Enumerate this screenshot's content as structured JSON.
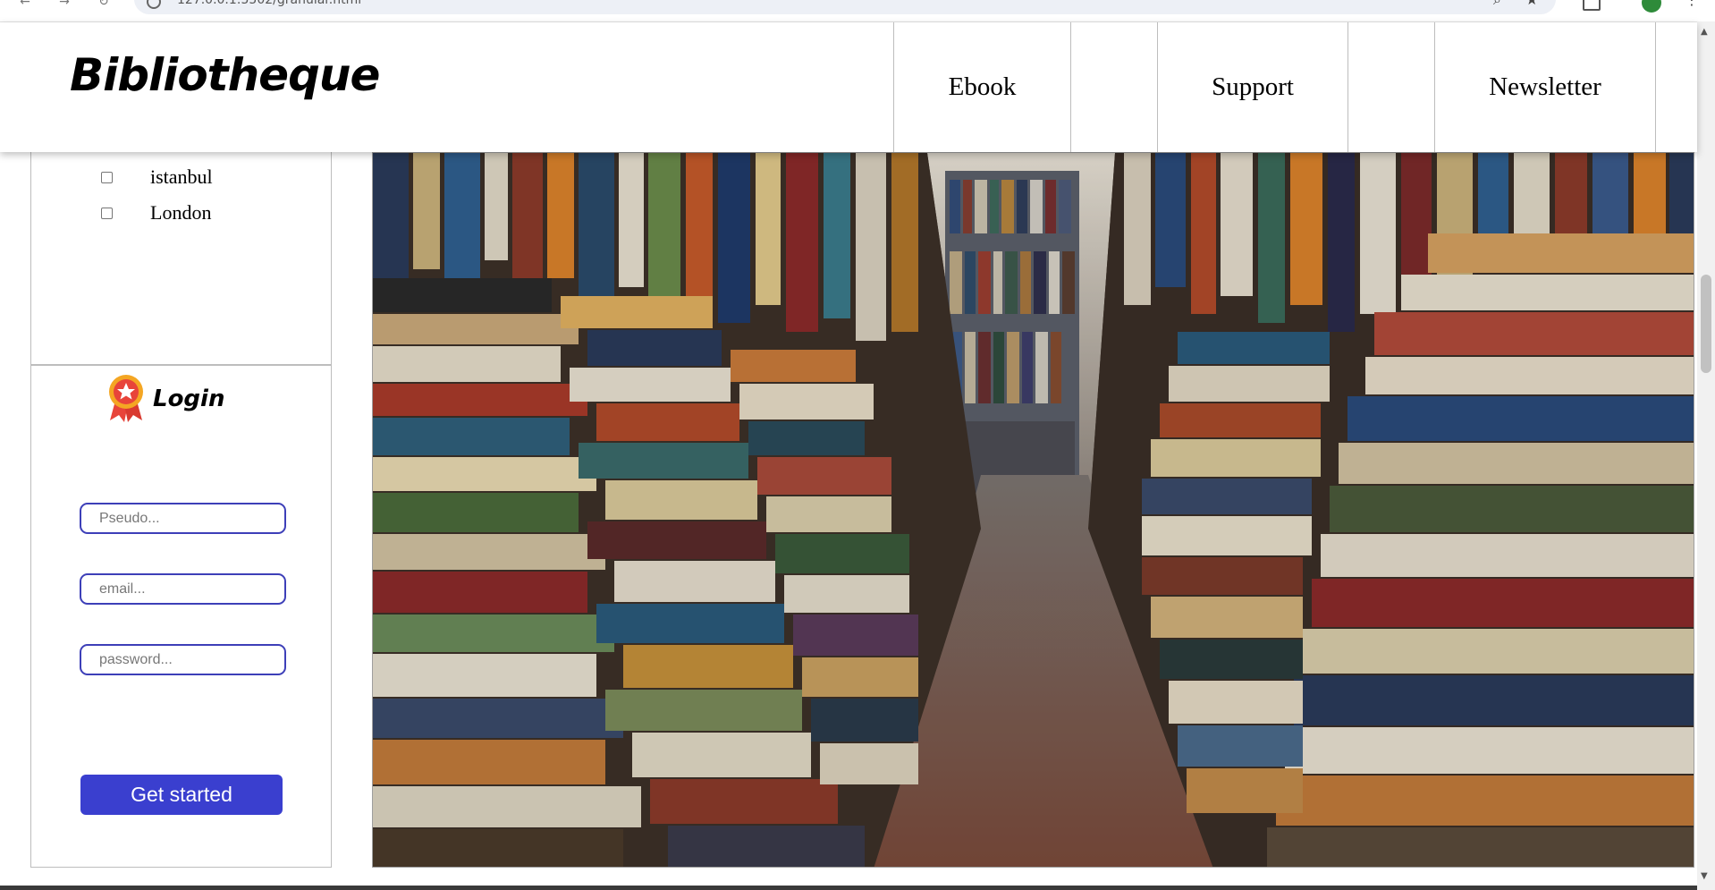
{
  "browser": {
    "url": "127.0.0.1:5502/granular.html"
  },
  "header": {
    "brand": "Bibliotheque",
    "nav": [
      "Ebook",
      "Support",
      "Newsletter"
    ]
  },
  "sidebar": {
    "cities": [
      {
        "label": "istanbul",
        "checked": false
      },
      {
        "label": "London",
        "checked": false
      }
    ],
    "login": {
      "title": "Login",
      "icon": "award-ribbon-icon",
      "pseudo_placeholder": "Pseudo...",
      "email_placeholder": "email...",
      "password_placeholder": "password...",
      "submit_label": "Get started",
      "accent_color": "#3a3fcf"
    }
  },
  "hero": {
    "image": "library-bookstacks-photo"
  }
}
